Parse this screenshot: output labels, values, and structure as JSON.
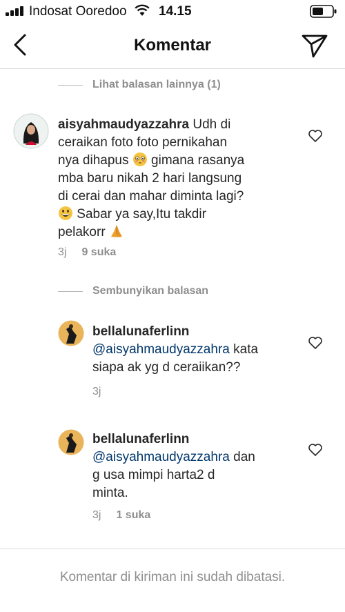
{
  "status": {
    "carrier": "Indosat Ooredoo",
    "time": "14.15"
  },
  "header": {
    "title": "Komentar",
    "back_icon": "chevron-left-icon",
    "send_icon": "send-icon"
  },
  "view_more_replies": "Lihat balasan lainnya (1)",
  "main_comment": {
    "username": "aisyahmaudyazzahra",
    "text_part1": "Udh di",
    "line2": "ceraikan foto foto pernikahan",
    "line3_a": "nya dihapus",
    "line3_b": "gimana rasanya",
    "line4": "mba baru nikah 2 hari langsung",
    "line5": "di cerai dan mahar diminta lagi?",
    "line6": "Sabar ya say,Itu takdir",
    "line7": "pelakorr",
    "time": "3j",
    "likes": "9 suka"
  },
  "hide_replies": "Sembunyikan balasan",
  "replies": [
    {
      "username": "bellalunaferlinn",
      "mention": "@aisyahmaudyazzahra",
      "line1_rest": "kata",
      "line2": "siapa ak yg d ceraiikan??",
      "time": "3j"
    },
    {
      "username": "bellalunaferlinn",
      "mention": "@aisyahmaudyazzahra",
      "line1_rest": "dan",
      "line2": "g usa mimpi harta2 d",
      "line3": "minta.",
      "time": "3j",
      "likes": "1 suka"
    }
  ],
  "footer": "Komentar di kiriman ini sudah dibatasi.",
  "colors": {
    "text": "#262626",
    "secondary": "#8e8e8e",
    "mention": "#00376b",
    "divider": "#dbdbdb"
  }
}
